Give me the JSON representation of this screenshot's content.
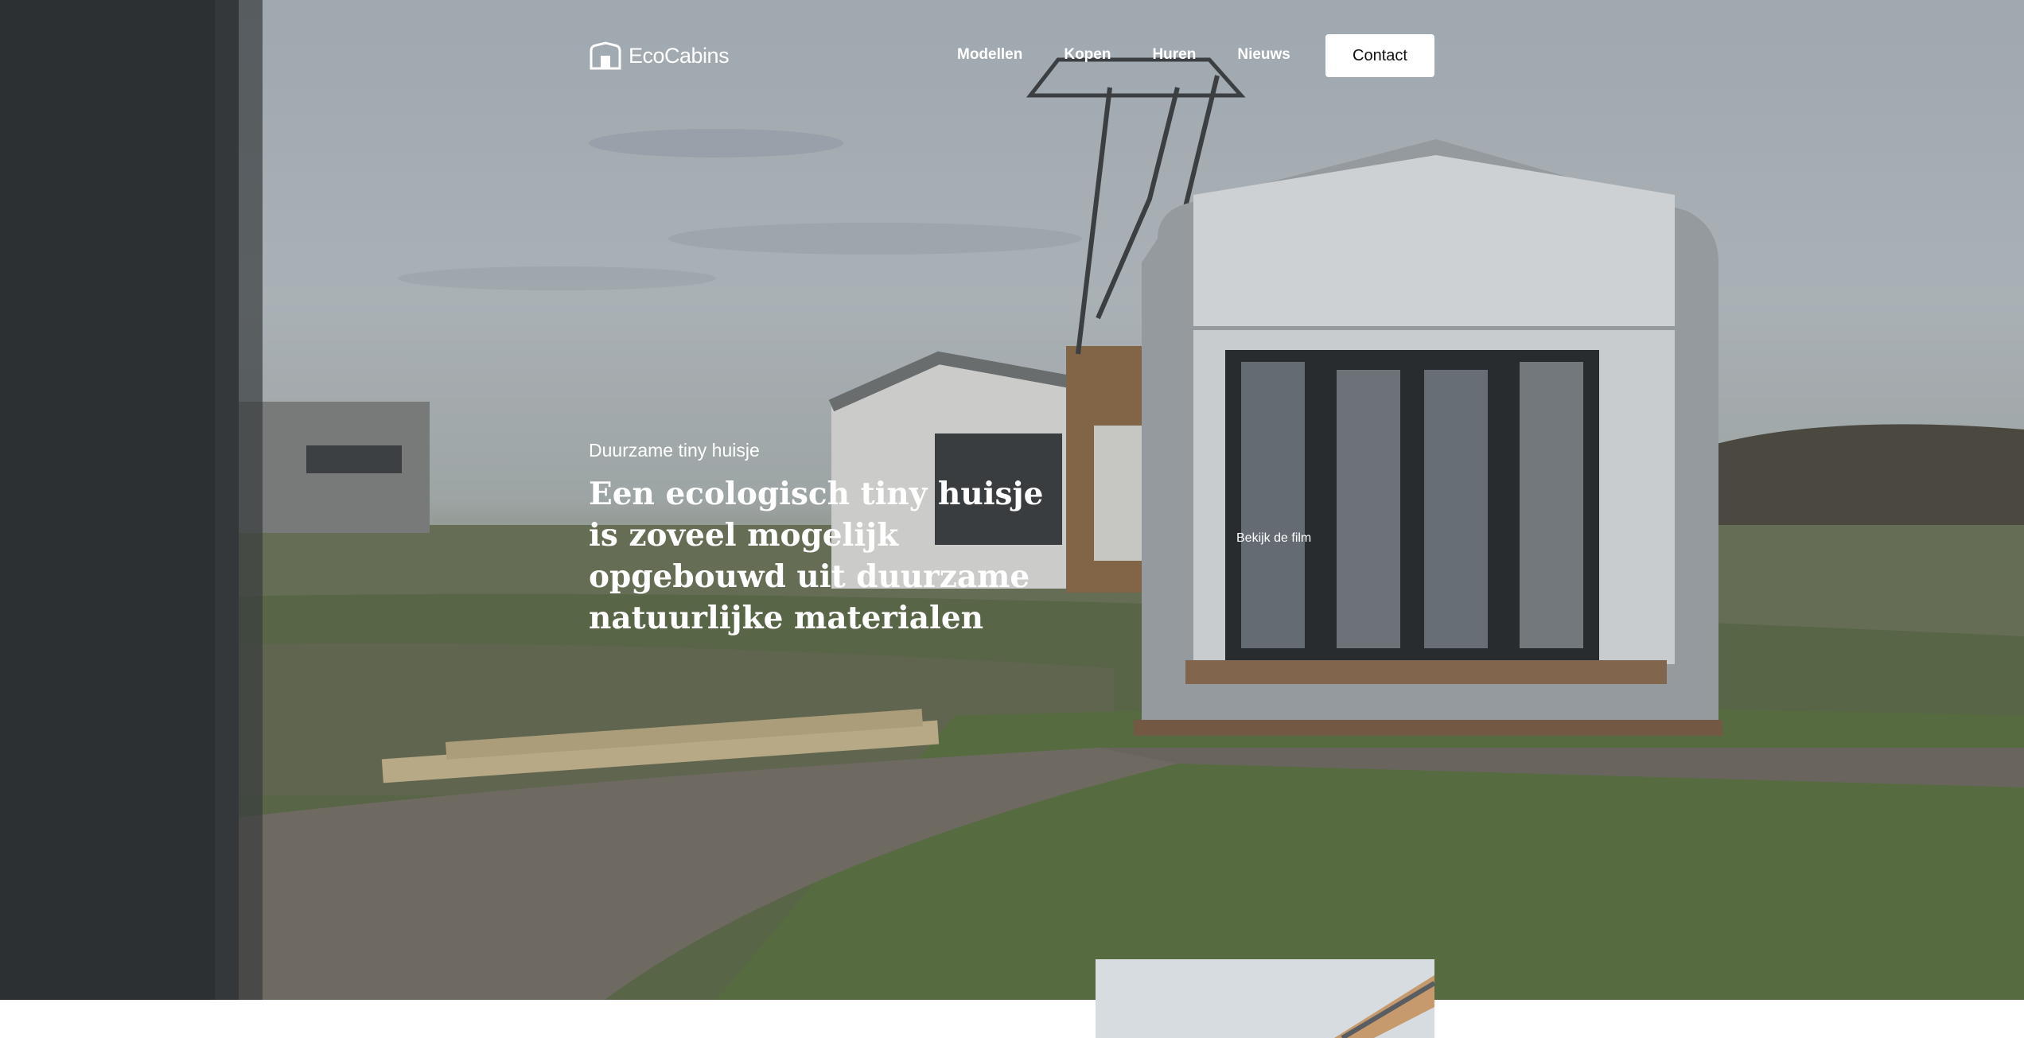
{
  "brand": {
    "name": "EcoCabins",
    "logo_icon": "cabin-logo-icon"
  },
  "nav": {
    "items": [
      {
        "label": "Modellen"
      },
      {
        "label": "Kopen"
      },
      {
        "label": "Huren"
      },
      {
        "label": "Nieuws"
      }
    ],
    "contact_label": "Contact"
  },
  "hero": {
    "eyebrow": "Duurzame tiny huisje",
    "headline": "Een ecologisch tiny huisje is zoveel mogelijk opgebouwd uit duurzame natuurlijke materialen",
    "film_link": "Bekijk de film"
  },
  "colors": {
    "nav_text": "#ffffff",
    "button_bg": "#ffffff",
    "button_text": "#111111"
  }
}
